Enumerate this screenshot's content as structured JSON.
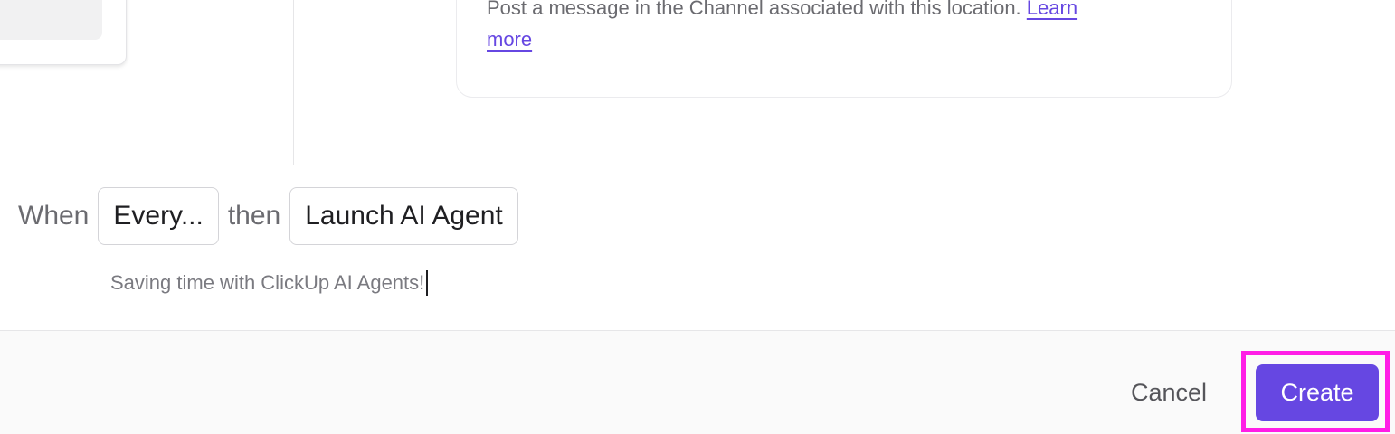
{
  "info_card": {
    "text": "Post a message in the Channel associated with this location.",
    "link_word_1": "Learn",
    "link_word_2": "more"
  },
  "rule": {
    "when_label": "When",
    "trigger_value": "Every...",
    "then_label": "then",
    "action_value": "Launch AI Agent",
    "message_text": "Saving time with ClickUp AI Agents!"
  },
  "footer": {
    "cancel_label": "Cancel",
    "create_label": "Create"
  },
  "colors": {
    "accent": "#6647e2",
    "highlight": "#ff1ee6"
  }
}
